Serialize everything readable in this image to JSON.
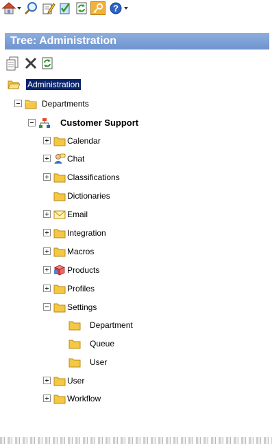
{
  "window": {
    "title": "Tree: Administration"
  },
  "toolbar": {
    "items": [
      {
        "name": "home-icon",
        "has_dropdown": true
      },
      {
        "name": "search-icon",
        "has_dropdown": false
      },
      {
        "name": "edit-icon",
        "has_dropdown": false
      },
      {
        "name": "checklist-icon",
        "has_dropdown": false
      },
      {
        "name": "refresh-icon",
        "has_dropdown": false
      },
      {
        "name": "key-icon",
        "has_dropdown": false
      },
      {
        "name": "help-icon",
        "has_dropdown": true
      }
    ]
  },
  "tree_toolbar": {
    "items": [
      "copy-icon",
      "delete-icon",
      "refresh-icon"
    ]
  },
  "tree": {
    "root": "Administration",
    "departments": "Departments",
    "department": "Customer Support",
    "children": [
      {
        "label": "Calendar",
        "icon": "folder-icon",
        "expander": "plus"
      },
      {
        "label": "Chat",
        "icon": "chat-user-icon",
        "expander": "plus"
      },
      {
        "label": "Classifications",
        "icon": "folder-icon",
        "expander": "plus"
      },
      {
        "label": "Dictionaries",
        "icon": "folder-icon",
        "expander": "none"
      },
      {
        "label": "Email",
        "icon": "envelope-icon",
        "expander": "plus"
      },
      {
        "label": "Integration",
        "icon": "folder-icon",
        "expander": "plus"
      },
      {
        "label": "Macros",
        "icon": "folder-icon",
        "expander": "plus"
      },
      {
        "label": "Products",
        "icon": "products-icon",
        "expander": "plus"
      },
      {
        "label": "Profiles",
        "icon": "folder-icon",
        "expander": "plus"
      },
      {
        "label": "Settings",
        "icon": "folder-icon",
        "expander": "minus"
      }
    ],
    "settings_children": [
      "Department",
      "Queue",
      "User"
    ],
    "tail_children": [
      {
        "label": "User",
        "icon": "folder-icon",
        "expander": "plus"
      },
      {
        "label": "Workflow",
        "icon": "folder-icon",
        "expander": "plus"
      }
    ]
  },
  "colors": {
    "title_bar": "#7a9dd6",
    "selection": "#0a246a",
    "folder": "#f5c842"
  }
}
